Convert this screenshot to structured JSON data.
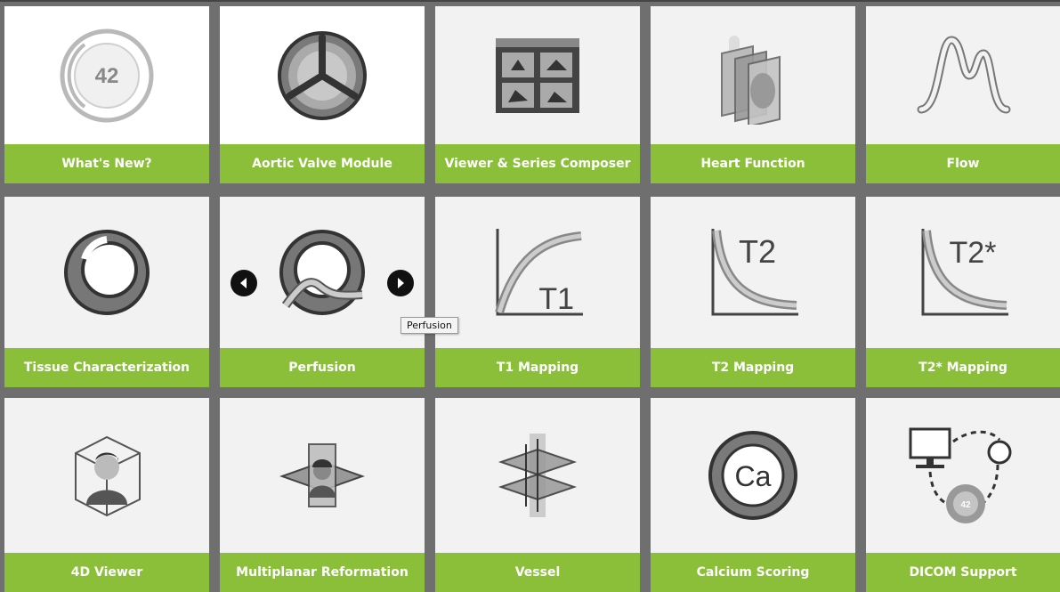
{
  "colors": {
    "label_bg": "#8bbf3a",
    "grid_gap": "#6f6f6f",
    "tile_bg": "#f2f2f2",
    "icon_gray": "#7a7a7a"
  },
  "tiles": [
    {
      "label": "What's New?",
      "icon": "whats-new-42-icon",
      "badge": "42"
    },
    {
      "label": "Aortic Valve Module",
      "icon": "aortic-valve-icon"
    },
    {
      "label": "Viewer & Series Composer",
      "icon": "viewer-grid-icon"
    },
    {
      "label": "Heart Function",
      "icon": "heart-function-icon"
    },
    {
      "label": "Flow",
      "icon": "flow-curve-icon"
    },
    {
      "label": "Tissue Characterization",
      "icon": "tissue-ring-icon"
    },
    {
      "label": "Perfusion",
      "icon": "perfusion-icon"
    },
    {
      "label": "T1 Mapping",
      "icon": "t1-curve-icon",
      "glyph": "T1"
    },
    {
      "label": "T2 Mapping",
      "icon": "t2-curve-icon",
      "glyph": "T2"
    },
    {
      "label": "T2* Mapping",
      "icon": "t2star-curve-icon",
      "glyph": "T2*"
    },
    {
      "label": "4D Viewer",
      "icon": "4d-viewer-cube-icon"
    },
    {
      "label": "Multiplanar Reformation",
      "icon": "multiplanar-planes-icon"
    },
    {
      "label": "Vessel",
      "icon": "vessel-planes-icon"
    },
    {
      "label": "Calcium Scoring",
      "icon": "calcium-ca-icon",
      "glyph": "Ca"
    },
    {
      "label": "DICOM Support",
      "icon": "dicom-network-icon",
      "badge": "42"
    }
  ],
  "tooltip": {
    "text": "Perfusion"
  }
}
